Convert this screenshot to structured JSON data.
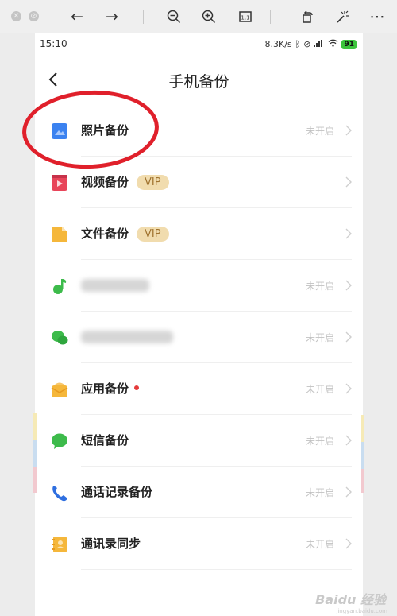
{
  "viewer": {
    "tools": [
      "back-arrow-icon",
      "forward-arrow-icon",
      "zoom-out-icon",
      "zoom-in-icon",
      "fit-icon",
      "rotate-icon",
      "magic-wand-icon",
      "more-icon"
    ]
  },
  "status_bar": {
    "time": "15:10",
    "speed": "8.3K/s",
    "battery": "91"
  },
  "header": {
    "title": "手机备份"
  },
  "items": [
    {
      "label": "照片备份",
      "status": "未开启",
      "icon": "photo-icon",
      "color": "#3b82f0"
    },
    {
      "label": "视频备份",
      "badge": "VIP",
      "icon": "video-icon",
      "color": "#e8455a"
    },
    {
      "label": "文件备份",
      "badge": "VIP",
      "icon": "file-icon",
      "color": "#f5b73b"
    },
    {
      "status": "未开启",
      "icon": "music-icon",
      "color": "#3dbb4b"
    },
    {
      "status": "未开启",
      "icon": "wechat-icon",
      "color": "#3dbb4b"
    },
    {
      "label": "应用备份",
      "status": "未开启",
      "icon": "app-icon",
      "color": "#f5b73b"
    },
    {
      "label": "短信备份",
      "status": "未开启",
      "icon": "message-icon",
      "color": "#3dbb4b"
    },
    {
      "label": "通话记录备份",
      "status": "未开启",
      "icon": "phone-icon",
      "color": "#2f6fe0"
    },
    {
      "label": "通讯录同步",
      "status": "未开启",
      "icon": "contacts-icon",
      "color": "#f5b73b"
    }
  ],
  "watermark": {
    "main": "Baidu 经验",
    "sub": "jingyan.baidu.com"
  },
  "colors": {
    "annotation": "#e0202b",
    "vip_bg": "#f1dcae",
    "vip_text": "#a0732f"
  }
}
